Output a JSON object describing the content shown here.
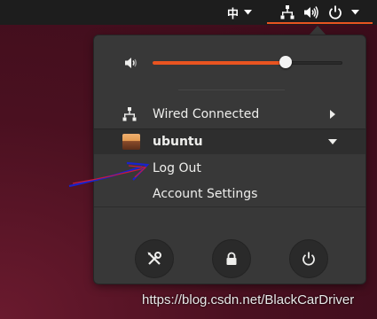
{
  "topbar": {
    "input_method": "中",
    "icons": [
      "network-icon",
      "volume-icon",
      "power-icon"
    ]
  },
  "volume": {
    "level": 0.7
  },
  "menu": {
    "wired_label": "Wired Connected",
    "user_label": "ubuntu",
    "logout_label": "Log Out",
    "account_settings_label": "Account Settings",
    "bottom_buttons": [
      "settings",
      "lock",
      "power"
    ]
  },
  "watermark": "https://blog.csdn.net/BlackCarDriver",
  "colors": {
    "accent": "#e95420",
    "menu_bg": "#383838",
    "topbar": "#1d1d1d",
    "annotation": "#1a22cc"
  }
}
